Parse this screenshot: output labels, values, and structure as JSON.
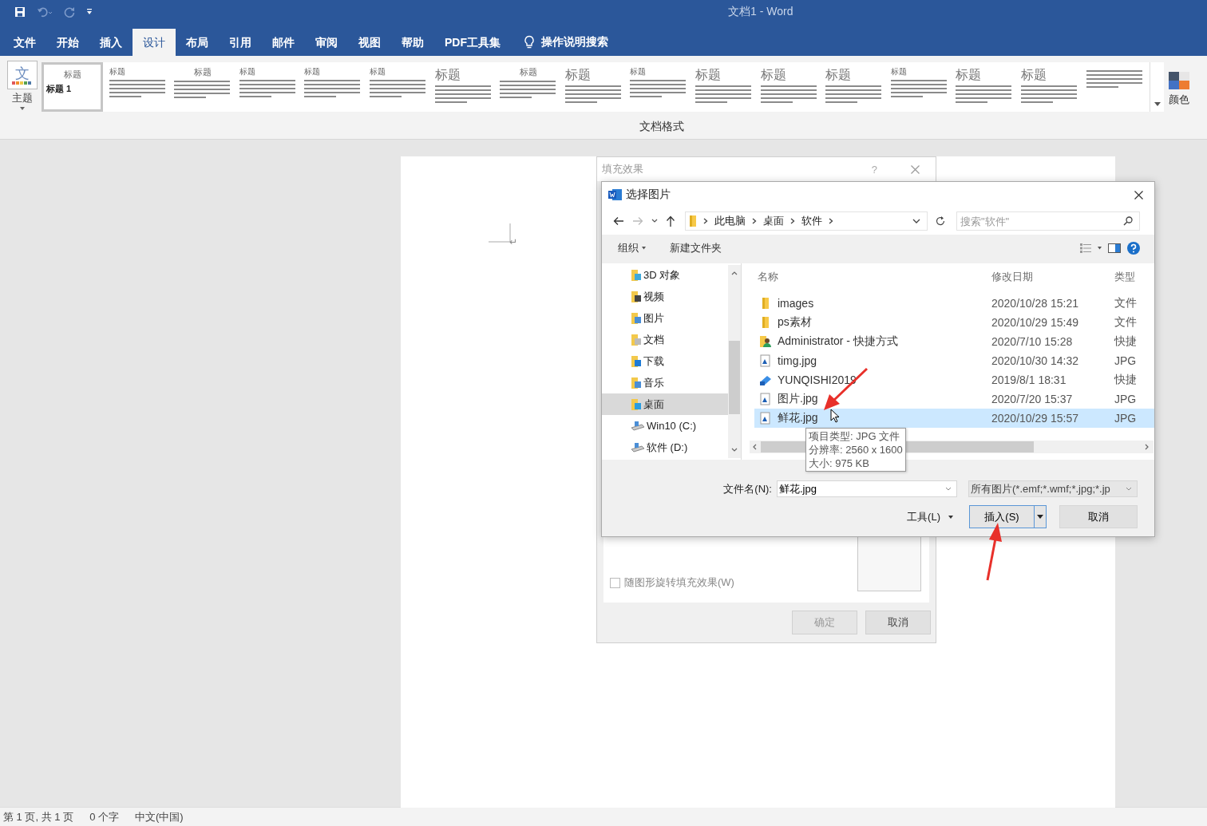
{
  "window": {
    "title": "文档1 - Word"
  },
  "tabs": [
    {
      "label": "文件",
      "selected": false
    },
    {
      "label": "开始",
      "selected": false
    },
    {
      "label": "插入",
      "selected": false
    },
    {
      "label": "设计",
      "selected": true
    },
    {
      "label": "布局",
      "selected": false
    },
    {
      "label": "引用",
      "selected": false
    },
    {
      "label": "邮件",
      "selected": false
    },
    {
      "label": "审阅",
      "selected": false
    },
    {
      "label": "视图",
      "selected": false
    },
    {
      "label": "帮助",
      "selected": false
    },
    {
      "label": "PDF工具集",
      "selected": false
    }
  ],
  "tell_me": {
    "label": "操作说明搜索"
  },
  "ribbon": {
    "theme_button": {
      "icon_text": "文",
      "label": "主题"
    },
    "style_gallery": [
      {
        "title": "标题",
        "subtitle": "标题 1",
        "kind": "centered",
        "selected": true
      },
      {
        "title": "标题",
        "kind": "small",
        "selected": false
      },
      {
        "title": "标题",
        "kind": "centered",
        "selected": false
      },
      {
        "title": "标题",
        "kind": "small",
        "selected": false
      },
      {
        "title": "标题",
        "kind": "small",
        "selected": false
      },
      {
        "title": "标题",
        "kind": "small",
        "selected": false
      },
      {
        "title": "标题",
        "kind": "large",
        "selected": false
      },
      {
        "title": "标题",
        "kind": "centered",
        "selected": false
      },
      {
        "title": "标题",
        "kind": "large",
        "selected": false
      },
      {
        "title": "标题",
        "kind": "small",
        "selected": false
      },
      {
        "title": "标题",
        "kind": "large",
        "selected": false
      },
      {
        "title": "标题",
        "kind": "large",
        "selected": false
      },
      {
        "title": "标题",
        "kind": "large",
        "selected": false
      },
      {
        "title": "标题",
        "kind": "small",
        "selected": false
      },
      {
        "title": "标题",
        "kind": "large",
        "selected": false
      },
      {
        "title": "标题",
        "kind": "large",
        "selected": false
      },
      {
        "kind": "small",
        "selected": false
      }
    ],
    "color_button": {
      "label": "颜色"
    },
    "group_label": "文档格式"
  },
  "document": {
    "paragraph_mark": "↵"
  },
  "fill_dialog": {
    "title": "填充效果",
    "help": "?",
    "rotate_checkbox": {
      "label": "随图形旋转填充效果(W)",
      "checked": false
    },
    "buttons": [
      {
        "label": "确定",
        "disabled": true
      },
      {
        "label": "取消",
        "disabled": false
      }
    ]
  },
  "picture_dialog": {
    "title": "选择图片",
    "breadcrumb": [
      "此电脑",
      "桌面",
      "软件"
    ],
    "search": {
      "placeholder": "搜索\"软件\""
    },
    "toolbar": [
      {
        "label": "组织",
        "dropdown": true
      },
      {
        "label": "新建文件夹",
        "dropdown": false
      }
    ],
    "nav_items": [
      {
        "label": "3D 对象",
        "kind": "objects",
        "selected": false
      },
      {
        "label": "视频",
        "kind": "video",
        "selected": false
      },
      {
        "label": "图片",
        "kind": "pictures",
        "selected": false
      },
      {
        "label": "文档",
        "kind": "documents",
        "selected": false
      },
      {
        "label": "下载",
        "kind": "downloads",
        "selected": false
      },
      {
        "label": "音乐",
        "kind": "music",
        "selected": false
      },
      {
        "label": "桌面",
        "kind": "desktop",
        "selected": true
      },
      {
        "label": "Win10 (C:)",
        "kind": "drive",
        "selected": false
      },
      {
        "label": "软件 (D:)",
        "kind": "drive",
        "selected": false
      }
    ],
    "columns": [
      "名称",
      "修改日期",
      "类型"
    ],
    "rows": [
      {
        "name": "images",
        "date": "2020/10/28 15:21",
        "type": "文件",
        "kind": "folder",
        "selected": false
      },
      {
        "name": "ps素材",
        "date": "2020/10/29 15:49",
        "type": "文件",
        "kind": "folder",
        "selected": false
      },
      {
        "name": "Administrator - 快捷方式",
        "date": "2020/7/10 15:28",
        "type": "快捷",
        "kind": "user-shortcut",
        "selected": false
      },
      {
        "name": "timg.jpg",
        "date": "2020/10/30 14:32",
        "type": "JPG",
        "kind": "image",
        "selected": false
      },
      {
        "name": "YUNQISHI2019",
        "date": "2019/8/1 18:31",
        "type": "快捷",
        "kind": "shortcut",
        "selected": false
      },
      {
        "name": "图片.jpg",
        "date": "2020/7/20 15:37",
        "type": "JPG",
        "kind": "image",
        "selected": false
      },
      {
        "name": "鲜花.jpg",
        "date": "2020/10/29 15:57",
        "type": "JPG",
        "kind": "image",
        "selected": true
      }
    ],
    "tooltip": [
      "项目类型: JPG 文件",
      "分辨率: 2560 x 1600",
      "大小: 975 KB"
    ],
    "filename": {
      "label": "文件名(N):",
      "value": "鲜花.jpg"
    },
    "filter": {
      "value": "所有图片(*.emf;*.wmf;*.jpg;*.jp"
    },
    "tools": {
      "label": "工具(L)"
    },
    "insert": {
      "label": "插入(S)"
    },
    "cancel": {
      "label": "取消"
    }
  },
  "status_bar": [
    "第 1 页, 共 1 页",
    "0 个字",
    "中文(中国)"
  ]
}
